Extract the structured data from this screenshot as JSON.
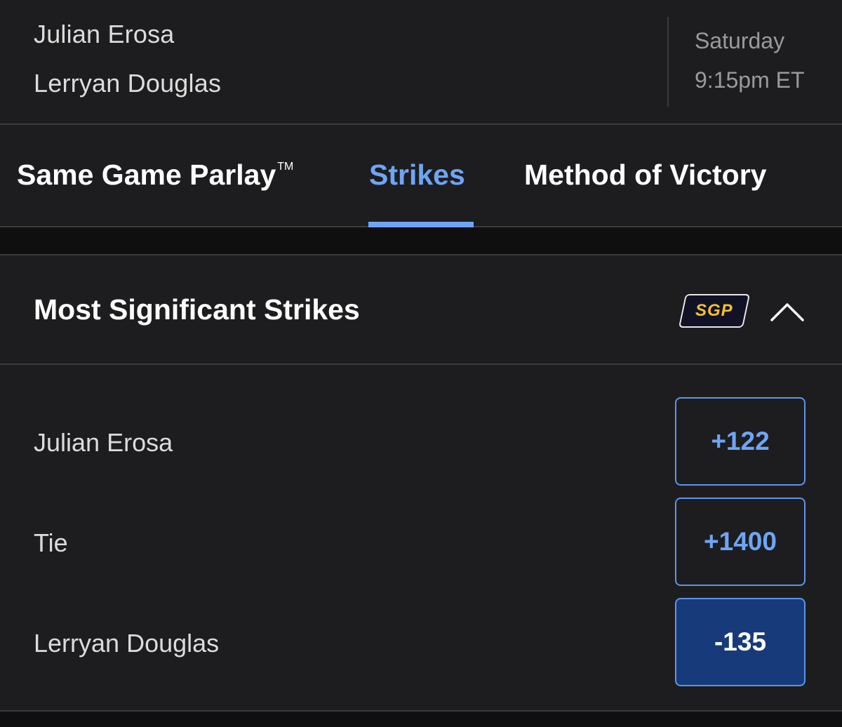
{
  "matchup": {
    "fighter_1": "Julian Erosa",
    "fighter_2": "Lerryan Douglas",
    "day": "Saturday",
    "time": "9:15pm ET"
  },
  "tabs": [
    {
      "label": "Same Game Parlay",
      "superscript": "TM",
      "active": false
    },
    {
      "label": "Strikes",
      "active": true
    },
    {
      "label": "Method of Victory",
      "active": false
    }
  ],
  "market": {
    "title": "Most Significant Strikes",
    "badge": "SGP",
    "options": [
      {
        "label": "Julian Erosa",
        "odds": "+122",
        "selected": false
      },
      {
        "label": "Tie",
        "odds": "+1400",
        "selected": false
      },
      {
        "label": "Lerryan Douglas",
        "odds": "-135",
        "selected": true
      }
    ]
  },
  "colors": {
    "accent": "#6ea5f5",
    "selected_bg": "#173a7a",
    "badge_text": "#f2c12e",
    "background": "#1d1d1f"
  },
  "icons": {
    "collapse": "chevron-up-icon"
  }
}
